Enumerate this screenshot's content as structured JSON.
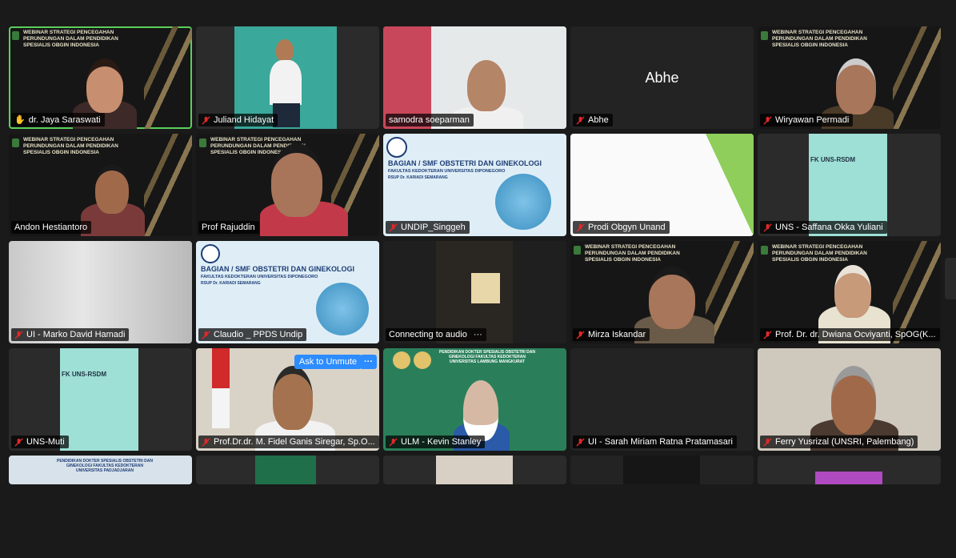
{
  "participants": [
    {
      "name": "dr. Jaya Saraswati",
      "muted": false,
      "slide": "WEBINAR STRATEGI PENCEGAHAN PERUNDUNGAN DALAM PENDIDIKAN SPESIALIS OBGIN INDONESIA"
    },
    {
      "name": "Juliand Hidayat",
      "muted": true
    },
    {
      "name": "samodra soeparman",
      "muted": false
    },
    {
      "name": "Abhe",
      "muted": true,
      "display": "Abhe"
    },
    {
      "name": "Wiryawan Permadi",
      "muted": true,
      "slide": "WEBINAR STRATEGI PENCEGAHAN PERUNDUNGAN DALAM PENDIDIKAN SPESIALIS OBGIN INDONESIA"
    },
    {
      "name": "Andon Hestiantoro",
      "muted": false,
      "slide": "WEBINAR STRATEGI PENCEGAHAN PERUNDUNGAN DALAM PENDIDIKAN SPESIALIS OBGIN INDONESIA"
    },
    {
      "name": "Prof Rajuddin",
      "muted": false,
      "slide": "WEBINAR STRATEGI PENCEGAHAN PERUNDUNGAN DALAM PENDIDIKAN SPESIALIS OBGIN INDONESIA"
    },
    {
      "name": "UNDIP_Singgeh",
      "muted": true,
      "slide": "BAGIAN / SMF OBSTETRI DAN GINEKOLOGI",
      "slide_sub": "FAKULTAS KEDOKTERAN UNIVERSITAS DIPONEGORO",
      "slide_sub2": "RSUP Dr. KARIADI SEMARANG"
    },
    {
      "name": "Prodi Obgyn Unand",
      "muted": true
    },
    {
      "name": "UNS - Saffana Okka Yuliani",
      "muted": true,
      "slide": "FK UNS-RSDM"
    },
    {
      "name": "UI - Marko David Hamadi",
      "muted": true
    },
    {
      "name": "Claudio _ PPDS Undip",
      "muted": true,
      "slide": "BAGIAN / SMF OBSTETRI DAN GINEKOLOGI",
      "slide_sub": "FAKULTAS KEDOKTERAN UNIVERSITAS DIPONEGORO",
      "slide_sub2": "RSUP Dr. KARIADI SEMARANG"
    },
    {
      "name": "Connecting to audio",
      "muted": false,
      "connecting": true
    },
    {
      "name": "Mirza Iskandar",
      "muted": true,
      "slide": "WEBINAR STRATEGI PENCEGAHAN PERUNDUNGAN DALAM PENDIDIKAN SPESIALIS OBGIN INDONESIA"
    },
    {
      "name": "Prof. Dr. dr. Dwiana Ocviyanti, SpOG(K...",
      "muted": true,
      "slide": "WEBINAR STRATEGI PENCEGAHAN PERUNDUNGAN DALAM PENDIDIKAN SPESIALIS OBGIN INDONESIA"
    },
    {
      "name": "UNS-Muti",
      "muted": true,
      "slide": "FK UNS-RSDM"
    },
    {
      "name": "Prof.Dr.dr. M. Fidel Ganis Siregar, Sp.O...",
      "muted": true,
      "ask_label": "Ask to Unmute",
      "more_label": "···"
    },
    {
      "name": "ULM - Kevin Stanley",
      "muted": true,
      "slide": "PENDIDIKAN DOKTER SPESIALIS OBSTETRI DAN GINEKOLOGI FAKULTAS KEDOKTERAN UNIVERSITAS LAMBUNG MANGKURAT"
    },
    {
      "name": "UI - Sarah Miriam Ratna Pratamasari",
      "muted": true
    },
    {
      "name": "Ferry Yusrizal (UNSRI, Palembang)",
      "muted": true
    }
  ],
  "bottom_row": {
    "slide": "PENDIDIKAN DOKTER SPESIALIS OBSTETRI DAN GINEKOLOGI FAKULTAS KEDOKTERAN UNIVERSITAS PADJADJARAN"
  },
  "colors": {
    "active_border": "#5ad05a",
    "muted_icon": "#e02828",
    "ask_button": "#2d8cff"
  }
}
